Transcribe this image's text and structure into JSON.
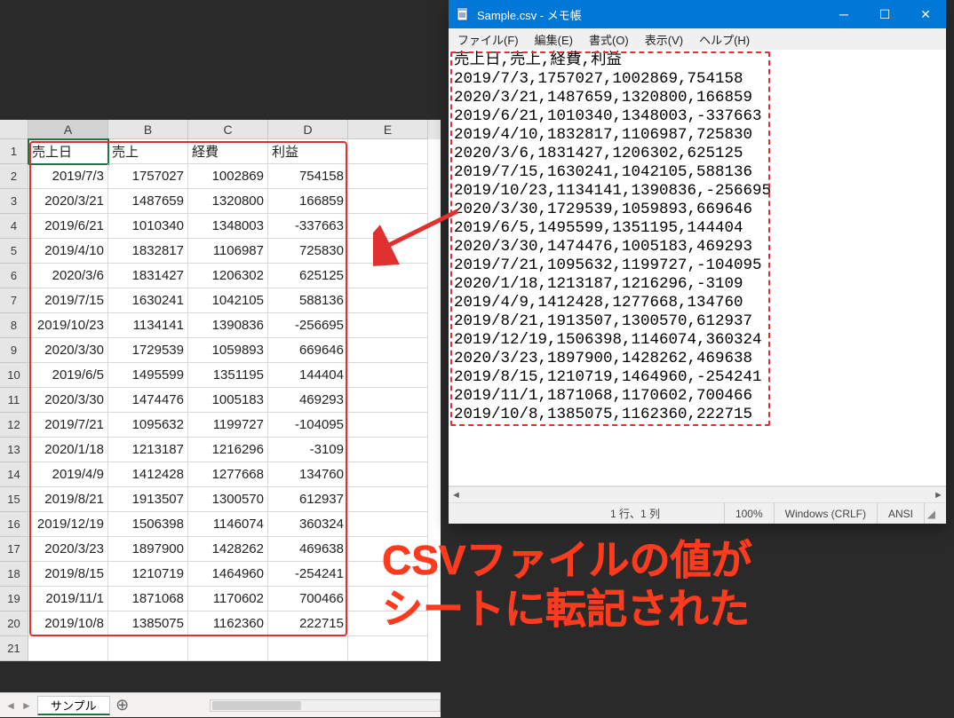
{
  "excel": {
    "columns": [
      "A",
      "B",
      "C",
      "D",
      "E"
    ],
    "headers": [
      "売上日",
      "売上",
      "経費",
      "利益"
    ],
    "rows": [
      [
        "2019/7/3",
        "1757027",
        "1002869",
        "754158"
      ],
      [
        "2020/3/21",
        "1487659",
        "1320800",
        "166859"
      ],
      [
        "2019/6/21",
        "1010340",
        "1348003",
        "-337663"
      ],
      [
        "2019/4/10",
        "1832817",
        "1106987",
        "725830"
      ],
      [
        "2020/3/6",
        "1831427",
        "1206302",
        "625125"
      ],
      [
        "2019/7/15",
        "1630241",
        "1042105",
        "588136"
      ],
      [
        "2019/10/23",
        "1134141",
        "1390836",
        "-256695"
      ],
      [
        "2020/3/30",
        "1729539",
        "1059893",
        "669646"
      ],
      [
        "2019/6/5",
        "1495599",
        "1351195",
        "144404"
      ],
      [
        "2020/3/30",
        "1474476",
        "1005183",
        "469293"
      ],
      [
        "2019/7/21",
        "1095632",
        "1199727",
        "-104095"
      ],
      [
        "2020/1/18",
        "1213187",
        "1216296",
        "-3109"
      ],
      [
        "2019/4/9",
        "1412428",
        "1277668",
        "134760"
      ],
      [
        "2019/8/21",
        "1913507",
        "1300570",
        "612937"
      ],
      [
        "2019/12/19",
        "1506398",
        "1146074",
        "360324"
      ],
      [
        "2020/3/23",
        "1897900",
        "1428262",
        "469638"
      ],
      [
        "2019/8/15",
        "1210719",
        "1464960",
        "-254241"
      ],
      [
        "2019/11/1",
        "1871068",
        "1170602",
        "700466"
      ],
      [
        "2019/10/8",
        "1385075",
        "1162360",
        "222715"
      ]
    ],
    "tab_label": "サンプル"
  },
  "notepad": {
    "title": "Sample.csv - メモ帳",
    "menu": {
      "file": "ファイル(F)",
      "edit": "編集(E)",
      "format": "書式(O)",
      "view": "表示(V)",
      "help": "ヘルプ(H)"
    },
    "lines": [
      "売上日,売上,経費,利益",
      "2019/7/3,1757027,1002869,754158",
      "2020/3/21,1487659,1320800,166859",
      "2019/6/21,1010340,1348003,-337663",
      "2019/4/10,1832817,1106987,725830",
      "2020/3/6,1831427,1206302,625125",
      "2019/7/15,1630241,1042105,588136",
      "2019/10/23,1134141,1390836,-256695",
      "2020/3/30,1729539,1059893,669646",
      "2019/6/5,1495599,1351195,144404",
      "2020/3/30,1474476,1005183,469293",
      "2019/7/21,1095632,1199727,-104095",
      "2020/1/18,1213187,1216296,-3109",
      "2019/4/9,1412428,1277668,134760",
      "2019/8/21,1913507,1300570,612937",
      "2019/12/19,1506398,1146074,360324",
      "2020/3/23,1897900,1428262,469638",
      "2019/8/15,1210719,1464960,-254241",
      "2019/11/1,1871068,1170602,700466",
      "2019/10/8,1385075,1162360,222715"
    ],
    "status": {
      "pos": "1 行、1 列",
      "zoom": "100%",
      "eol": "Windows (CRLF)",
      "enc": "ANSI"
    }
  },
  "caption": {
    "line1": "CSVファイルの値が",
    "line2": "シートに転記された"
  },
  "chart_data": {
    "type": "table",
    "title": "Sample.csv",
    "columns": [
      "売上日",
      "売上",
      "経費",
      "利益"
    ],
    "rows": [
      [
        "2019/7/3",
        1757027,
        1002869,
        754158
      ],
      [
        "2020/3/21",
        1487659,
        1320800,
        166859
      ],
      [
        "2019/6/21",
        1010340,
        1348003,
        -337663
      ],
      [
        "2019/4/10",
        1832817,
        1106987,
        725830
      ],
      [
        "2020/3/6",
        1831427,
        1206302,
        625125
      ],
      [
        "2019/7/15",
        1630241,
        1042105,
        588136
      ],
      [
        "2019/10/23",
        1134141,
        1390836,
        -256695
      ],
      [
        "2020/3/30",
        1729539,
        1059893,
        669646
      ],
      [
        "2019/6/5",
        1495599,
        1351195,
        144404
      ],
      [
        "2020/3/30",
        1474476,
        1005183,
        469293
      ],
      [
        "2019/7/21",
        1095632,
        1199727,
        -104095
      ],
      [
        "2020/1/18",
        1213187,
        1216296,
        -3109
      ],
      [
        "2019/4/9",
        1412428,
        1277668,
        134760
      ],
      [
        "2019/8/21",
        1913507,
        1300570,
        612937
      ],
      [
        "2019/12/19",
        1506398,
        1146074,
        360324
      ],
      [
        "2020/3/23",
        1897900,
        1428262,
        469638
      ],
      [
        "2019/8/15",
        1210719,
        1464960,
        -254241
      ],
      [
        "2019/11/1",
        1871068,
        1170602,
        700466
      ],
      [
        "2019/10/8",
        1385075,
        1162360,
        222715
      ]
    ]
  }
}
